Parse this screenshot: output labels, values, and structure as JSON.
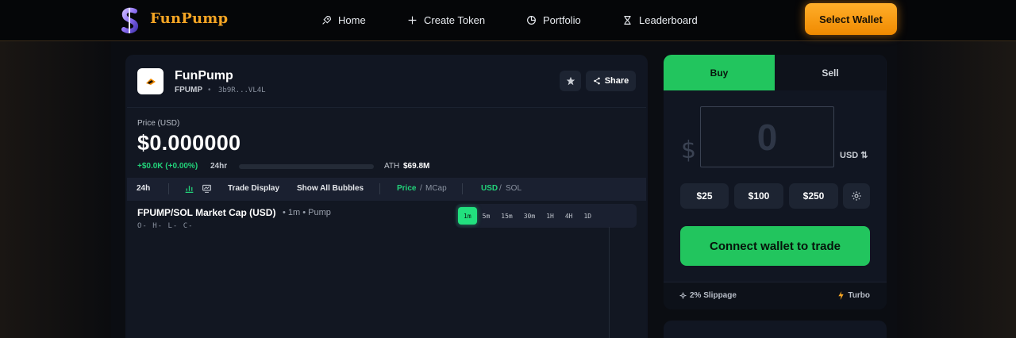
{
  "nav": {
    "brand": "FunPump",
    "items": [
      {
        "label": "Home",
        "icon": "rocket-icon"
      },
      {
        "label": "Create Token",
        "icon": "plus-icon"
      },
      {
        "label": "Portfolio",
        "icon": "pie-chart-icon"
      },
      {
        "label": "Leaderboard",
        "icon": "hourglass-icon"
      }
    ],
    "wallet_button": "Select Wallet"
  },
  "token": {
    "name": "FunPump",
    "ticker": "FPUMP",
    "separator": "•",
    "address": "3b9R...VL4L",
    "share_label": "Share"
  },
  "price": {
    "label": "Price (USD)",
    "value": "$0.000000",
    "change": "+$0.0K (+0.00%)",
    "period": "24hr",
    "progress": 0,
    "ath_label": "ATH",
    "ath_value": "$69.8M"
  },
  "toolbar": {
    "period": "24h",
    "trade_display": "Trade Display",
    "show_bubbles": "Show All Bubbles",
    "price_opt": "Price",
    "mcap_opt": "MCap",
    "usd_opt": "USD",
    "sol_opt": "SOL",
    "slash": "/"
  },
  "chart": {
    "title": "FPUMP/SOL Market Cap (USD)",
    "subtitle": "• 1m • Pump",
    "ohlc": "O-  H-  L-  C-",
    "timeframes": [
      "1m",
      "5m",
      "15m",
      "30m",
      "1H",
      "4H",
      "1D"
    ],
    "active_timeframe": "1m"
  },
  "trade": {
    "tabs": {
      "buy": "Buy",
      "sell": "Sell"
    },
    "active_tab": "Buy",
    "currency_symbol": "$",
    "amount_placeholder": "0",
    "currency": "USD ⇅",
    "quick_amounts": [
      "$25",
      "$100",
      "$250"
    ],
    "connect_label": "Connect wallet to trade",
    "slippage": "2% Slippage",
    "turbo": "Turbo"
  },
  "colors": {
    "accent_green": "#22c55e",
    "accent_orange": "#f5a524",
    "background": "#0b0d12",
    "panel": "#111622"
  }
}
